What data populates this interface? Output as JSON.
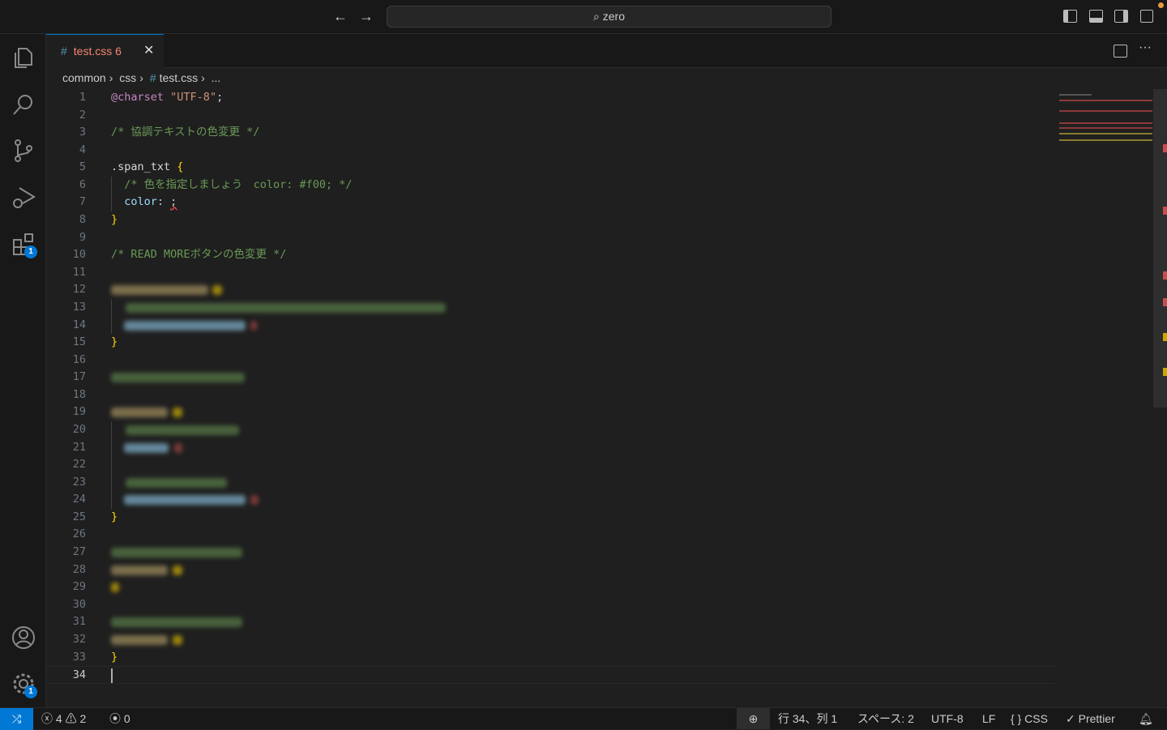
{
  "titlebar": {
    "back_icon": "arrow-left",
    "forward_icon": "arrow-right",
    "search_text": "zero",
    "search_icon": "search-icon"
  },
  "activity": {
    "items": [
      "explorer",
      "search",
      "source-control",
      "run-debug",
      "extensions",
      "accounts",
      "manage"
    ],
    "extensions_badge": "1",
    "manage_badge": "1"
  },
  "tab": {
    "icon": "#",
    "name": "test.css",
    "problems": "6",
    "close": "✕"
  },
  "breadcrumb": [
    "common",
    "css",
    "test.css",
    "..."
  ],
  "colors": {
    "accent": "#0078d4",
    "comment": "#6a9955",
    "property": "#9cdcfe",
    "atrule": "#c586c0",
    "string": "#ce9178",
    "brace": "#ffd700",
    "error": "#f14c4c",
    "warning": "#cca700"
  },
  "lines": [
    [
      [
        "@charset",
        "#c586c0"
      ],
      [
        " ",
        ""
      ],
      [
        "\"UTF-8\"",
        "#ce9178"
      ],
      [
        ";",
        "#cccccc"
      ]
    ],
    [],
    [
      [
        "/* 協調テキストの色変更 */",
        "#6a9955"
      ]
    ],
    [],
    [
      [
        ".span_txt ",
        "#d7d7d7"
      ],
      [
        "{",
        "#ffd700"
      ]
    ],
    [
      [
        "  /* 色を指定しましょう　color: #f00; */",
        "#6a9955"
      ]
    ],
    [
      [
        "  color",
        "#9cdcfe"
      ],
      [
        ": ",
        "#cccccc"
      ],
      [
        ";",
        "#cccccc"
      ]
    ],
    [
      [
        "}",
        "#ffd700"
      ]
    ],
    [],
    [
      [
        "/* READ MOREボタンの色変更 */",
        "#6a9955"
      ]
    ],
    [],
    "blurred",
    "blurred",
    "blurred",
    [
      [
        "}",
        "#ffd700"
      ]
    ],
    [],
    "blurred",
    [],
    "blurred",
    "blurred",
    "blurred",
    [],
    "blurred",
    "blurred",
    [
      [
        "}",
        "#ffd700"
      ]
    ],
    [],
    "blurred",
    "blurred",
    "blurred",
    [],
    "blurred",
    "blurred",
    [
      [
        "}",
        "#ffd700"
      ]
    ],
    []
  ],
  "current_line": 34,
  "status": {
    "errors": "4",
    "warnings": "2",
    "ports": "0",
    "position": "行 34、列 1",
    "spaces": "スペース: 2",
    "encoding": "UTF-8",
    "eol": "LF",
    "language": "CSS",
    "formatter": "Prettier"
  }
}
